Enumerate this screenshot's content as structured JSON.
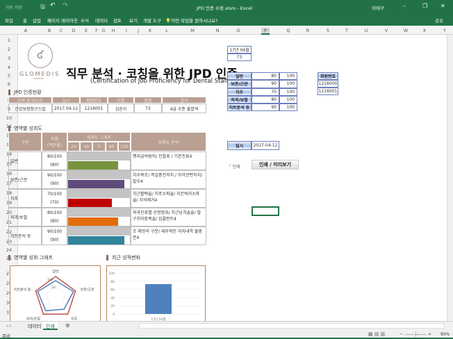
{
  "titlebar": {
    "autosave": "자동 저장",
    "title": "JPD 인증 수정.xlsm  -  Excel",
    "user": "이태구"
  },
  "ribbon": {
    "tabs": [
      "파일",
      "홈",
      "삽입",
      "페이지 레이아웃",
      "수식",
      "데이터",
      "검토",
      "보기",
      "개발 도구"
    ],
    "search": "어떤 작업을 원하시나요?",
    "share": "공유"
  },
  "columns": [
    "A",
    "B",
    "C",
    "D",
    "E",
    "F",
    "G",
    "H",
    "I",
    "J",
    "K",
    "L",
    "M",
    "N",
    "O",
    "P",
    "Q",
    "R",
    "S",
    "T",
    "U",
    "V",
    "W",
    "X",
    "Y"
  ],
  "rows": [
    "1",
    "2",
    "3",
    "4",
    "5",
    "6",
    "7",
    "8",
    "9",
    "10",
    "11",
    "12",
    "13",
    "14",
    "15",
    "16",
    "17",
    "18",
    "19",
    "20",
    "21",
    "22",
    "23",
    "24",
    "25",
    "27",
    "28",
    "29",
    "30",
    "31"
  ],
  "logo": {
    "text": "GLOMEDIS",
    "sub": "COMPANY"
  },
  "title": "직무 분석 · 코칭을 위한 JPD 인증",
  "subtitle": "(Certification of Job Proficiency for Dental Staff)",
  "cert": {
    "section": "JPD 인증현황",
    "headers": [
      "자격 및 테스트",
      "일시",
      "회원번호",
      "이름",
      "총점",
      "결과"
    ],
    "values": [
      "건강보험청구스킬",
      "2017.04.12",
      "1216001",
      "김순이",
      "73",
      "4급 수준 불합격"
    ]
  },
  "achieve": {
    "section": "영역별 성취도",
    "h_area": "구분",
    "h_score": "득점\n(백분율)",
    "h_graph": "성취도 그래프",
    "h_ticks": [
      "20",
      "40",
      "0",
      "80",
      "100"
    ],
    "h_analysis": "성취도 분석",
    "rows": [
      {
        "area": "일반",
        "score": "80/100",
        "pct": "(80)",
        "value": 80,
        "color": "#77933c",
        "analysis": "행위급여원칙/ 진찰료 / 기본진료4"
      },
      {
        "area": "보존/근관",
        "score": "90/100",
        "pct": "(90)",
        "value": 90,
        "color": "#604a7b",
        "analysis": "치수복조/ 즉일충전처치 / 치각관련처치/ 발수4"
      },
      {
        "area": "치주",
        "score": "70/100",
        "pct": "(70)",
        "value": 70,
        "color": "#c00000",
        "analysis": "치근활택술/ 치주소파술/ 치은박리소파술/ 치석제거4"
      },
      {
        "area": "외과/보철",
        "score": "80/100",
        "pct": "(80)",
        "value": 80,
        "color": "#e36c09",
        "analysis": "외과진료별 산정범위/ 치근낭치술술/ 발구치이장복술/ 임플란트4"
      },
      {
        "area": "치트분석 등",
        "score": "90/100",
        "pct": "(90)",
        "value": 90,
        "color": "#31859c",
        "analysis": "조 제진의 구분/ 세부적인 처치내역 불충분4"
      }
    ]
  },
  "side": {
    "month": "17년 04월",
    "total": "73",
    "scores": [
      {
        "label": "일반",
        "score": "80",
        "max": "100"
      },
      {
        "label": "보존/근관",
        "score": "90",
        "max": "100"
      },
      {
        "label": "치주",
        "score": "70",
        "max": "100"
      },
      {
        "label": "외과/보철",
        "score": "80",
        "max": "100"
      },
      {
        "label": "치트분석 등",
        "score": "90",
        "max": "100"
      }
    ],
    "member_header": "회원번호",
    "members": [
      "1216000",
      "1216001"
    ],
    "date_label": "일시",
    "date": "2017-04-12",
    "print_check": "인쇄",
    "print_button": "인쇄 / 미리보기"
  },
  "charts": {
    "radar_section": "영역별 성취 그래프",
    "bar_section": "최근 성적변화"
  },
  "chart_data": [
    {
      "type": "radar",
      "categories": [
        "일반",
        "보존/근관",
        "치주",
        "외과/보철",
        "치트분석 등"
      ],
      "ticks": [
        "100",
        "50",
        "-"
      ],
      "series": [
        {
          "values": [
            80,
            90,
            70,
            80,
            90
          ],
          "color": "#4f81bd"
        },
        {
          "values": [
            100,
            100,
            100,
            100,
            100
          ],
          "color": "#c0504d"
        }
      ]
    },
    {
      "type": "bar",
      "categories": [
        "17년 04월"
      ],
      "values": [
        73
      ],
      "ylim": [
        0,
        100
      ],
      "yticks": [
        "0",
        "20",
        "40",
        "60",
        "80",
        "100"
      ],
      "color": "#4f81bd",
      "grid": true
    }
  ],
  "sheets": [
    "데이터",
    "인쇄"
  ],
  "active_sheet": "인쇄",
  "status": {
    "ready": "준비",
    "zoom": "90%"
  }
}
